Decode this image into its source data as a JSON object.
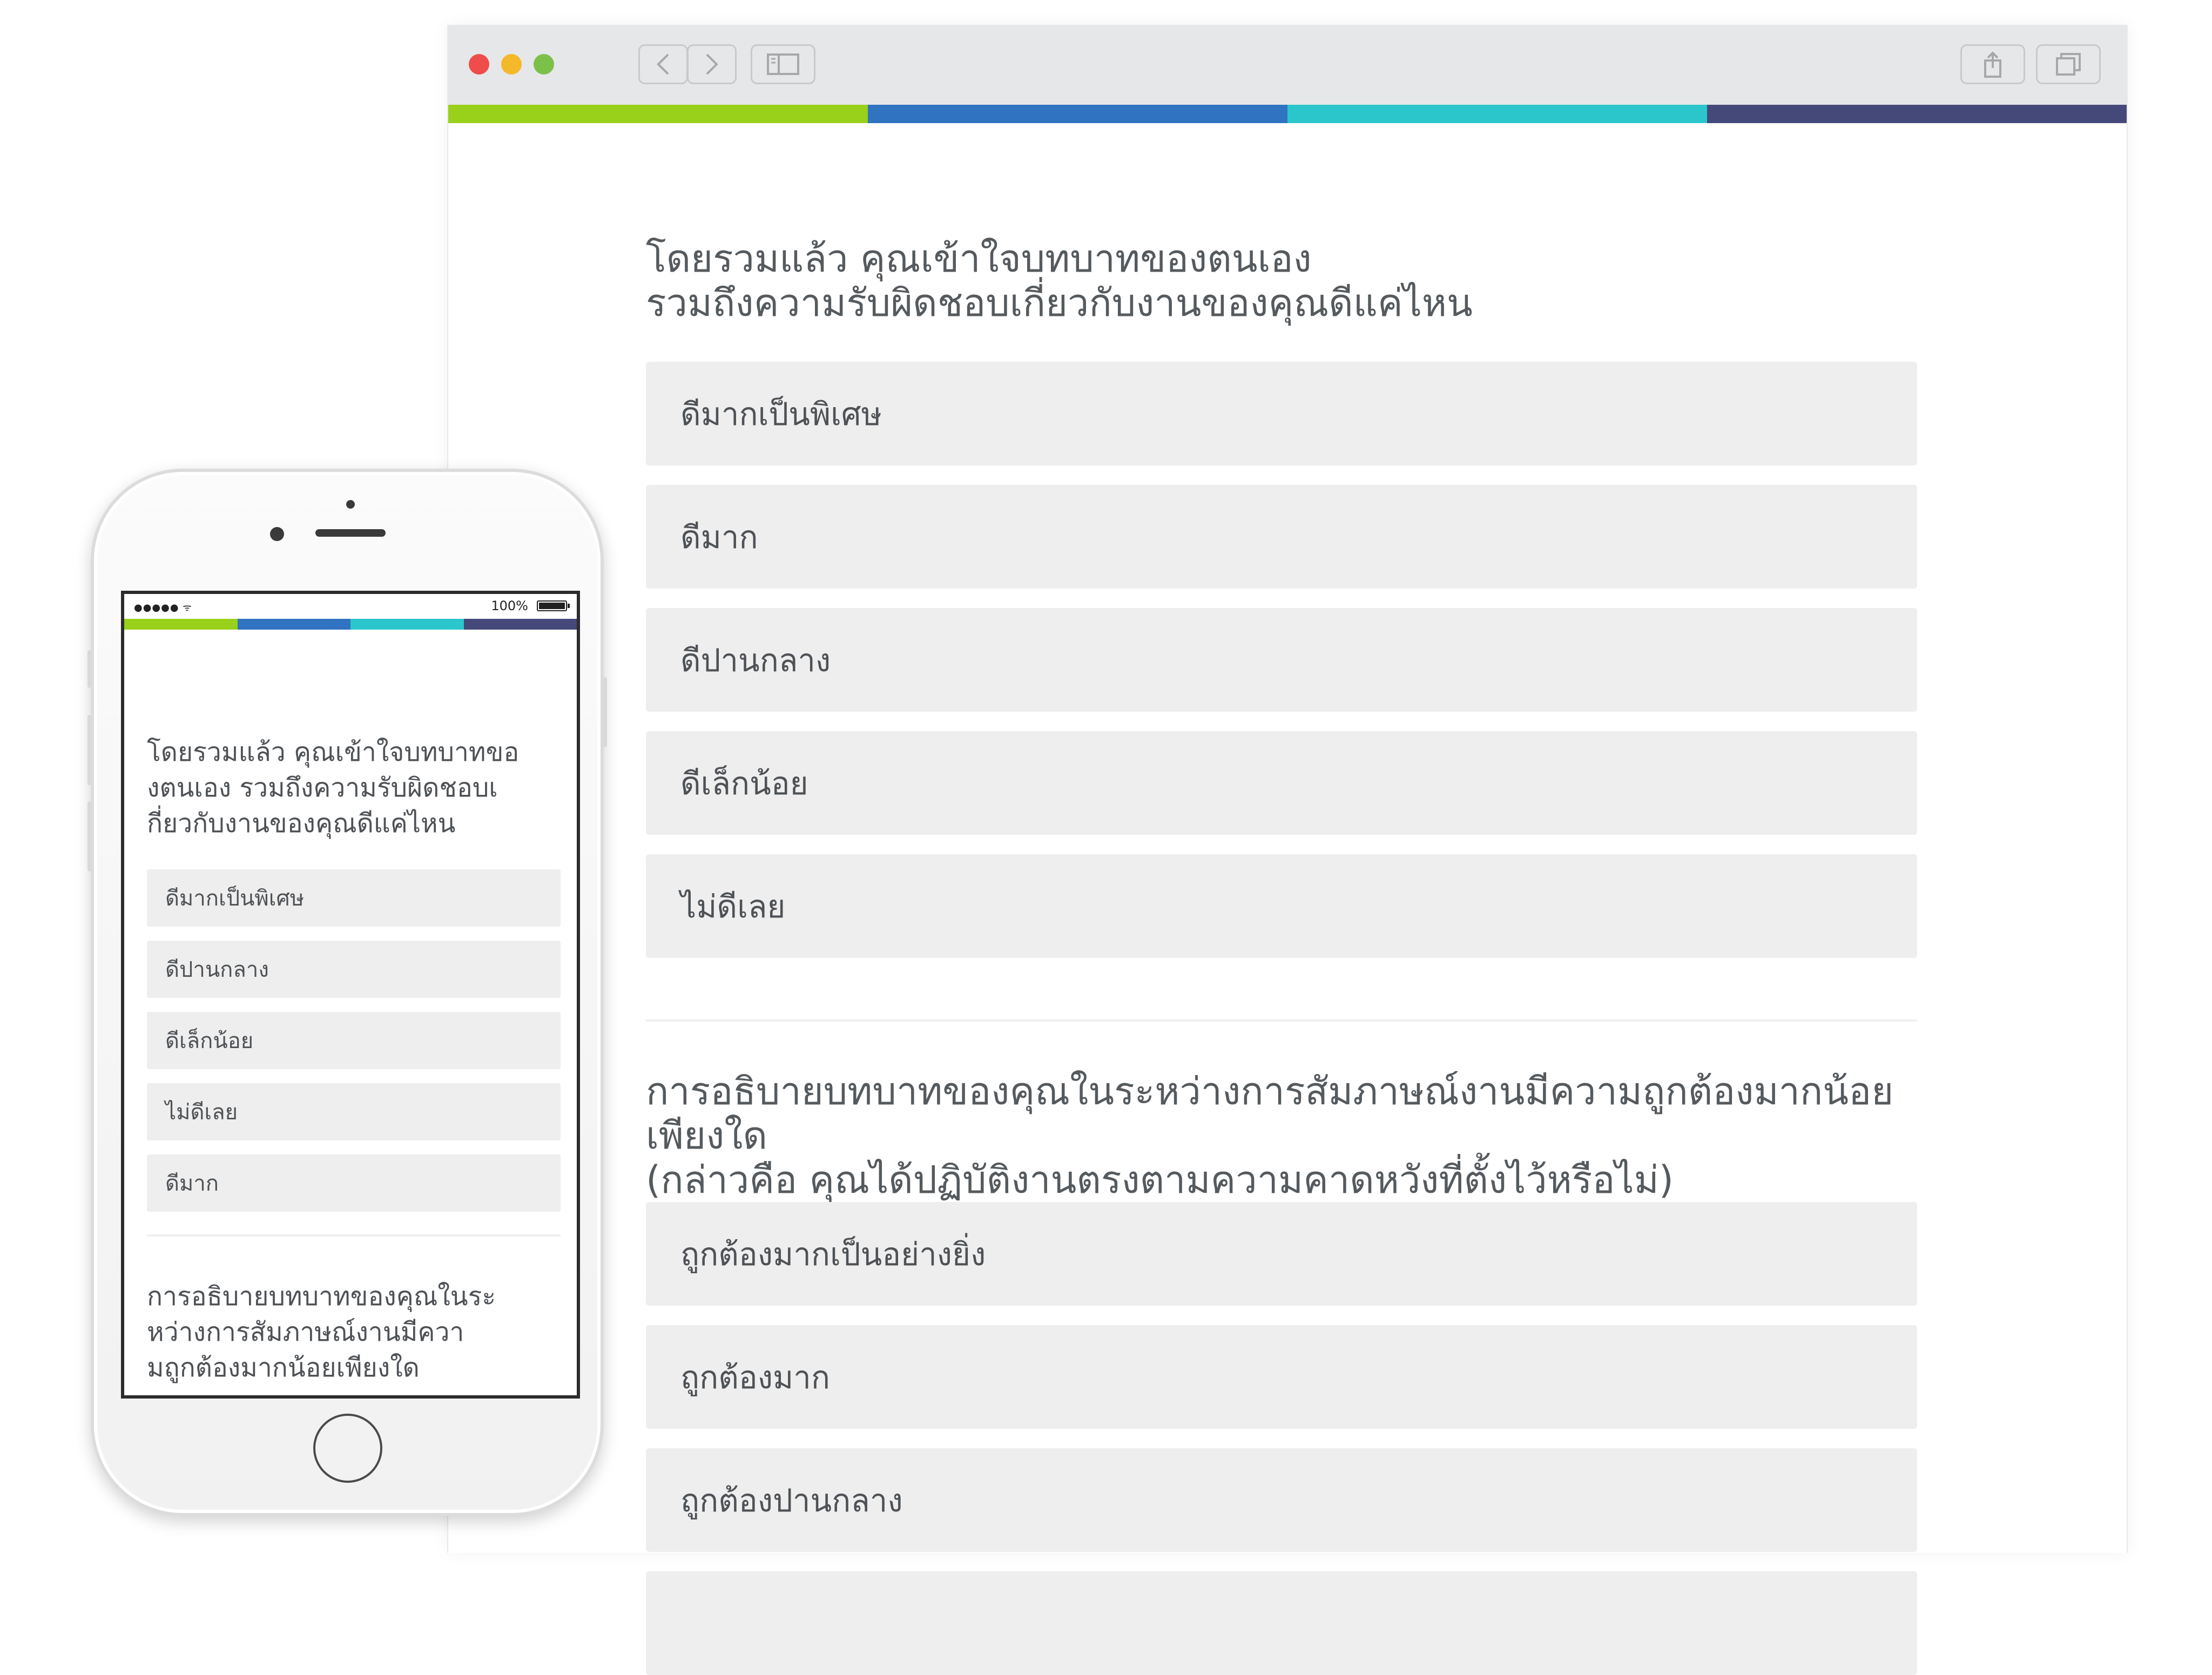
{
  "colors": {
    "progress": [
      "#99d019",
      "#2f73c1",
      "#2ac6cc",
      "#45497a"
    ],
    "option_bg": "#eeeeee",
    "text": "#555a5e"
  },
  "browser": {
    "toolbar_icons": [
      "back-icon",
      "forward-icon",
      "sidebar-icon",
      "share-icon",
      "tabs-icon"
    ],
    "question1": {
      "line1": "โดยรวมแล้ว คุณเข้าใจบทบาทของตนเอง",
      "line2": "รวมถึงความรับผิดชอบเกี่ยวกับงานของคุณดีแค่ไหน",
      "options": [
        "ดีมากเป็นพิเศษ",
        "ดีมาก",
        "ดีปานกลาง",
        "ดีเล็กน้อย",
        "ไม่ดีเลย"
      ]
    },
    "question2": {
      "line1": "การอธิบายบทบาทของคุณในระหว่างการสัมภาษณ์งานมีความถูกต้องมากน้อยเพียงใด",
      "line2": "(กล่าวคือ คุณได้ปฏิบัติงานตรงตามความคาดหวังที่ตั้งไว้หรือไม่)",
      "options": [
        "ถูกต้องมากเป็นอย่างยิ่ง",
        "ถูกต้องมาก",
        "ถูกต้องปานกลาง"
      ]
    }
  },
  "phone": {
    "status": {
      "signal": "●●●●● ᯤ",
      "battery": "100%"
    },
    "question1": {
      "line1": "โดยรวมแล้ว คุณเข้าใจบทบาทขอ",
      "line2": "งตนเอง รวมถึงความรับผิดชอบเ",
      "line3": "กี่ยวกับงานของคุณดีแค่ไหน",
      "options": [
        "ดีมากเป็นพิเศษ",
        "ดีปานกลาง",
        "ดีเล็กน้อย",
        "ไม่ดีเลย",
        "ดีมาก"
      ]
    },
    "question2": {
      "line1": "การอธิบายบทบาทของคุณในระ",
      "line2": "หว่างการสัมภาษณ์งานมีควา",
      "line3": "มถูกต้องมากน้อยเพียงใด"
    }
  }
}
